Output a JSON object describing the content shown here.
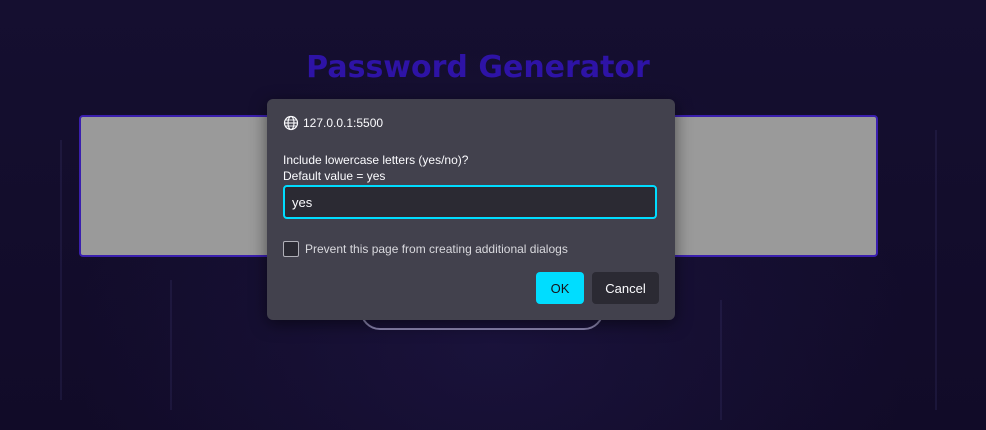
{
  "app": {
    "title": "Password Generator"
  },
  "dialog": {
    "origin": "127.0.0.1:5500",
    "message_line1": "Include lowercase letters (yes/no)?",
    "message_line2": "Default value = yes",
    "input_value": "yes",
    "checkbox_label": "Prevent this page from creating additional dialogs",
    "checkbox_checked": false,
    "ok_label": "OK",
    "cancel_label": "Cancel"
  },
  "colors": {
    "background": "#120d2c",
    "title": "#2e13a6",
    "dialog_bg": "#42414d",
    "accent": "#00ddff"
  },
  "icons": {
    "origin_icon": "globe-icon"
  }
}
